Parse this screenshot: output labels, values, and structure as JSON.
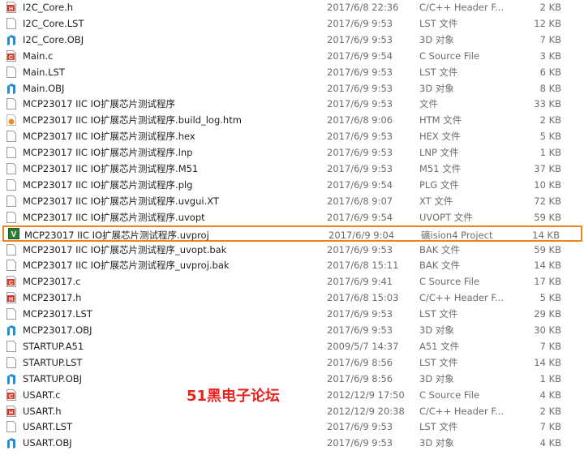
{
  "files": [
    {
      "name": "I2C_Core.h",
      "date": "2017/6/8 22:36",
      "type": "C/C++ Header F...",
      "size": "2 KB",
      "icon": "h-file-icon"
    },
    {
      "name": "I2C_Core.LST",
      "date": "2017/6/9 9:53",
      "type": "LST 文件",
      "size": "12 KB",
      "icon": "blank-file-icon"
    },
    {
      "name": "I2C_Core.OBJ",
      "date": "2017/6/9 9:53",
      "type": "3D 对象",
      "size": "7 KB",
      "icon": "3d-object-icon"
    },
    {
      "name": "Main.c",
      "date": "2017/6/9 9:54",
      "type": "C Source File",
      "size": "3 KB",
      "icon": "c-file-icon"
    },
    {
      "name": "Main.LST",
      "date": "2017/6/9 9:53",
      "type": "LST 文件",
      "size": "6 KB",
      "icon": "blank-file-icon"
    },
    {
      "name": "Main.OBJ",
      "date": "2017/6/9 9:53",
      "type": "3D 对象",
      "size": "8 KB",
      "icon": "3d-object-icon"
    },
    {
      "name": "MCP23017 IIC IO扩展芯片测试程序",
      "date": "2017/6/9 9:53",
      "type": "文件",
      "size": "33 KB",
      "icon": "blank-file-icon"
    },
    {
      "name": "MCP23017 IIC IO扩展芯片测试程序.build_log.htm",
      "date": "2017/6/8 9:06",
      "type": "HTM 文件",
      "size": "2 KB",
      "icon": "htm-file-icon"
    },
    {
      "name": "MCP23017 IIC IO扩展芯片测试程序.hex",
      "date": "2017/6/9 9:53",
      "type": "HEX 文件",
      "size": "5 KB",
      "icon": "blank-file-icon"
    },
    {
      "name": "MCP23017 IIC IO扩展芯片测试程序.lnp",
      "date": "2017/6/9 9:53",
      "type": "LNP 文件",
      "size": "1 KB",
      "icon": "blank-file-icon"
    },
    {
      "name": "MCP23017 IIC IO扩展芯片测试程序.M51",
      "date": "2017/6/9 9:53",
      "type": "M51 文件",
      "size": "37 KB",
      "icon": "blank-file-icon"
    },
    {
      "name": "MCP23017 IIC IO扩展芯片测试程序.plg",
      "date": "2017/6/9 9:54",
      "type": "PLG 文件",
      "size": "10 KB",
      "icon": "blank-file-icon"
    },
    {
      "name": "MCP23017 IIC IO扩展芯片测试程序.uvgui.XT",
      "date": "2017/6/8 9:07",
      "type": "XT 文件",
      "size": "72 KB",
      "icon": "blank-file-icon"
    },
    {
      "name": "MCP23017 IIC IO扩展芯片测试程序.uvopt",
      "date": "2017/6/9 9:54",
      "type": "UVOPT 文件",
      "size": "59 KB",
      "icon": "blank-file-icon"
    },
    {
      "name": "MCP23017 IIC IO扩展芯片测试程序.uvproj",
      "date": "2017/6/9 9:04",
      "type": "礦ision4 Project",
      "size": "14 KB",
      "icon": "uvision-project-icon",
      "selected": true
    },
    {
      "name": "MCP23017 IIC IO扩展芯片测试程序_uvopt.bak",
      "date": "2017/6/9 9:53",
      "type": "BAK 文件",
      "size": "59 KB",
      "icon": "blank-file-icon"
    },
    {
      "name": "MCP23017 IIC IO扩展芯片测试程序_uvproj.bak",
      "date": "2017/6/8 15:11",
      "type": "BAK 文件",
      "size": "14 KB",
      "icon": "blank-file-icon"
    },
    {
      "name": "MCP23017.c",
      "date": "2017/6/9 9:41",
      "type": "C Source File",
      "size": "17 KB",
      "icon": "c-file-icon"
    },
    {
      "name": "MCP23017.h",
      "date": "2017/6/8 15:03",
      "type": "C/C++ Header F...",
      "size": "5 KB",
      "icon": "h-file-icon"
    },
    {
      "name": "MCP23017.LST",
      "date": "2017/6/9 9:53",
      "type": "LST 文件",
      "size": "29 KB",
      "icon": "blank-file-icon"
    },
    {
      "name": "MCP23017.OBJ",
      "date": "2017/6/9 9:53",
      "type": "3D 对象",
      "size": "30 KB",
      "icon": "3d-object-icon"
    },
    {
      "name": "STARTUP.A51",
      "date": "2009/5/7 14:37",
      "type": "A51 文件",
      "size": "7 KB",
      "icon": "blank-file-icon"
    },
    {
      "name": "STARTUP.LST",
      "date": "2017/6/9 8:56",
      "type": "LST 文件",
      "size": "14 KB",
      "icon": "blank-file-icon"
    },
    {
      "name": "STARTUP.OBJ",
      "date": "2017/6/9 8:56",
      "type": "3D 对象",
      "size": "1 KB",
      "icon": "3d-object-icon"
    },
    {
      "name": "USART.c",
      "date": "2012/12/9 17:50",
      "type": "C Source File",
      "size": "4 KB",
      "icon": "c-file-icon"
    },
    {
      "name": "USART.h",
      "date": "2012/12/9 20:38",
      "type": "C/C++ Header F...",
      "size": "2 KB",
      "icon": "h-file-icon"
    },
    {
      "name": "USART.LST",
      "date": "2017/6/9 9:53",
      "type": "LST 文件",
      "size": "7 KB",
      "icon": "blank-file-icon"
    },
    {
      "name": "USART.OBJ",
      "date": "2017/6/9 9:53",
      "type": "3D 对象",
      "size": "4 KB",
      "icon": "3d-object-icon"
    }
  ],
  "watermark": "51黑电子论坛",
  "colors": {
    "selection_border": "#f0841c",
    "watermark": "#e8231e"
  }
}
